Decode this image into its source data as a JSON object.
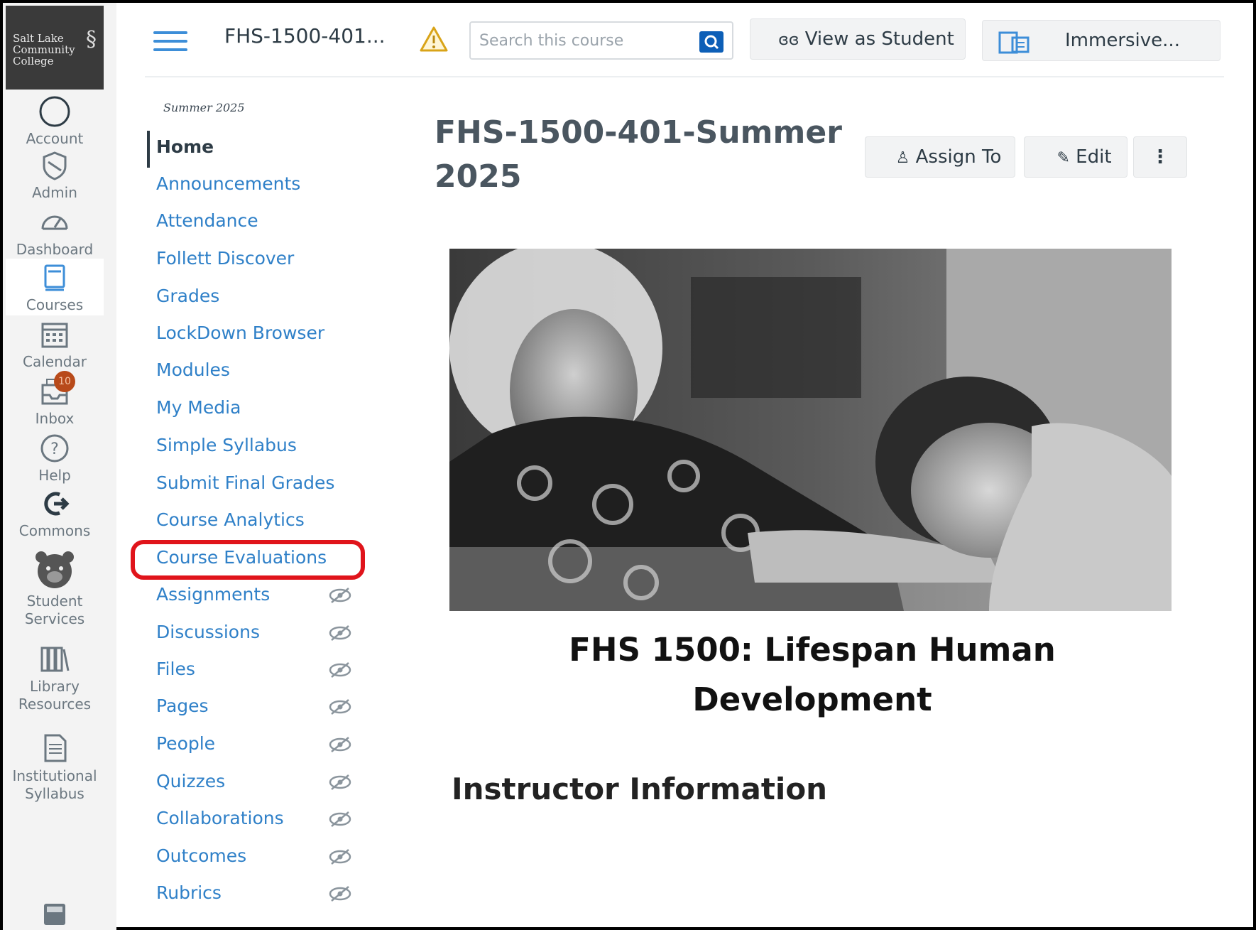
{
  "global_nav": {
    "logo_lines": [
      "Salt Lake",
      "Community",
      "College"
    ],
    "items": [
      {
        "label": "Account",
        "icon": "account-circle-icon"
      },
      {
        "label": "Admin",
        "icon": "shield-icon"
      },
      {
        "label": "Dashboard",
        "icon": "speedometer-icon"
      },
      {
        "label": "Courses",
        "icon": "book-icon"
      },
      {
        "label": "Calendar",
        "icon": "calendar-icon"
      },
      {
        "label": "Inbox",
        "icon": "inbox-icon",
        "badge": "10"
      },
      {
        "label": "Help",
        "icon": "help-icon"
      },
      {
        "label": "Commons",
        "icon": "commons-arrow-icon"
      },
      {
        "label": "Student Services",
        "icon": "bear-icon"
      },
      {
        "label": "Library Resources",
        "icon": "library-books-icon"
      },
      {
        "label": "Institutional Syllabus",
        "icon": "document-icon"
      }
    ]
  },
  "header": {
    "breadcrumb": "FHS-1500-401...",
    "search_placeholder": "Search this course",
    "view_as_student": "View as Student",
    "immersive": "Immersive..."
  },
  "course_nav": {
    "term": "Summer 2025",
    "items": [
      {
        "label": "Home",
        "hidden": false
      },
      {
        "label": "Announcements",
        "hidden": false
      },
      {
        "label": "Attendance",
        "hidden": false
      },
      {
        "label": "Follett Discover",
        "hidden": false
      },
      {
        "label": "Grades",
        "hidden": false
      },
      {
        "label": "LockDown Browser",
        "hidden": false
      },
      {
        "label": "Modules",
        "hidden": false
      },
      {
        "label": "My Media",
        "hidden": false
      },
      {
        "label": "Simple Syllabus",
        "hidden": false
      },
      {
        "label": "Submit Final Grades",
        "hidden": false
      },
      {
        "label": "Course Analytics",
        "hidden": false
      },
      {
        "label": "Course Evaluations",
        "hidden": false,
        "highlighted": true
      },
      {
        "label": "Assignments",
        "hidden": true
      },
      {
        "label": "Discussions",
        "hidden": true
      },
      {
        "label": "Files",
        "hidden": true
      },
      {
        "label": "Pages",
        "hidden": true
      },
      {
        "label": "People",
        "hidden": true
      },
      {
        "label": "Quizzes",
        "hidden": true
      },
      {
        "label": "Collaborations",
        "hidden": true
      },
      {
        "label": "Outcomes",
        "hidden": true
      },
      {
        "label": "Rubrics",
        "hidden": true
      }
    ]
  },
  "main": {
    "title": "FHS-1500-401-Summer 2025",
    "assign_to": "Assign To",
    "edit": "Edit",
    "more": "⋮",
    "course_heading": "FHS 1500: Lifespan Human Development",
    "instructor_heading": "Instructor Information"
  },
  "colors": {
    "link": "#2f80c8",
    "highlight_border": "#e0141b",
    "badge": "#b84a1a",
    "search_button": "#0d5fb7"
  }
}
